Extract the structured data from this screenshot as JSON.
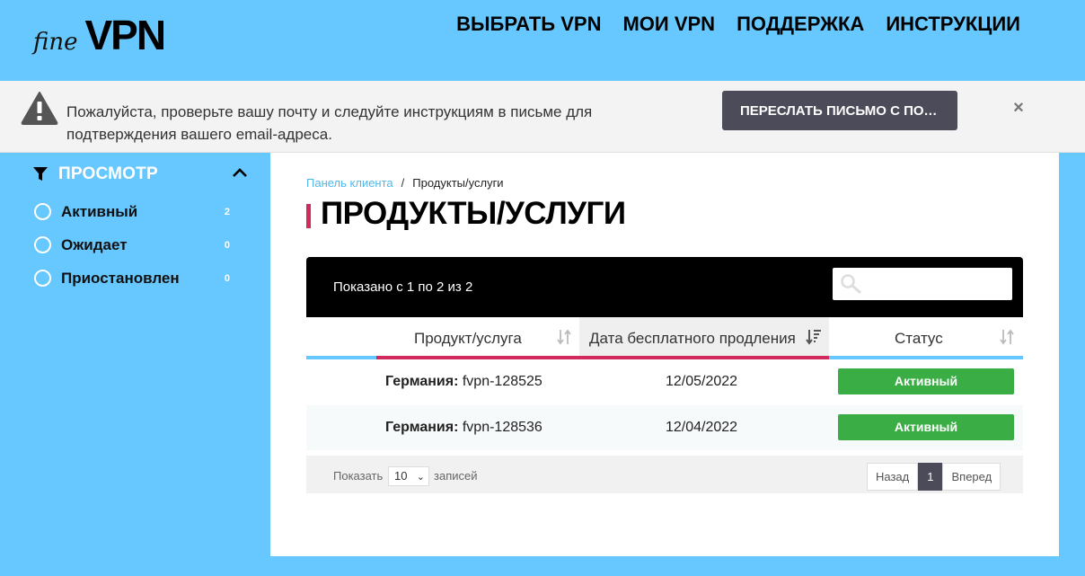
{
  "logo": {
    "fine": "fine",
    "vpn": "VPN"
  },
  "nav": [
    "ВЫБРАТЬ VPN",
    "МОИ VPN",
    "ПОДДЕРЖКА",
    "ИНСТРУКЦИИ"
  ],
  "alert": {
    "line1": "Пожалуйста, проверьте вашу почту и следуйте инструкциям в письме для",
    "line2": "подтверждения вашего email-адреса.",
    "button": "ПЕРЕСЛАТЬ ПИСЬМО С ПОДТВЕРЖДЕНИЕМ",
    "close": "×"
  },
  "sidebar": {
    "title": "ПРОСМОТР",
    "items": [
      {
        "label": "Активный",
        "count": "2"
      },
      {
        "label": "Ожидает",
        "count": "0"
      },
      {
        "label": "Приостановлен",
        "count": "0"
      }
    ]
  },
  "breadcrumb": {
    "home": "Панель клиента",
    "sep": "/",
    "current": "Продукты/услуги"
  },
  "page_title": "ПРОДУКТЫ/УСЛУГИ",
  "table": {
    "shown": "Показано с 1 по 2 из 2",
    "search_placeholder": "",
    "columns": [
      "Продукт/услуга",
      "Дата бесплатного продления",
      "Статус"
    ],
    "rows": [
      {
        "country": "Германия:",
        "service": "fvpn-128525",
        "date": "12/05/2022",
        "status": "Активный"
      },
      {
        "country": "Германия:",
        "service": "fvpn-128536",
        "date": "12/04/2022",
        "status": "Активный"
      }
    ],
    "footer": {
      "show": "Показать",
      "per_page": "10",
      "records": "записей"
    },
    "pager": {
      "prev": "Назад",
      "page": "1",
      "next": "Вперед"
    }
  },
  "colors": {
    "bg": "#66c8fe",
    "accent": "#d12a5c",
    "status": "#3aae45",
    "dark": "#4b4b59"
  }
}
